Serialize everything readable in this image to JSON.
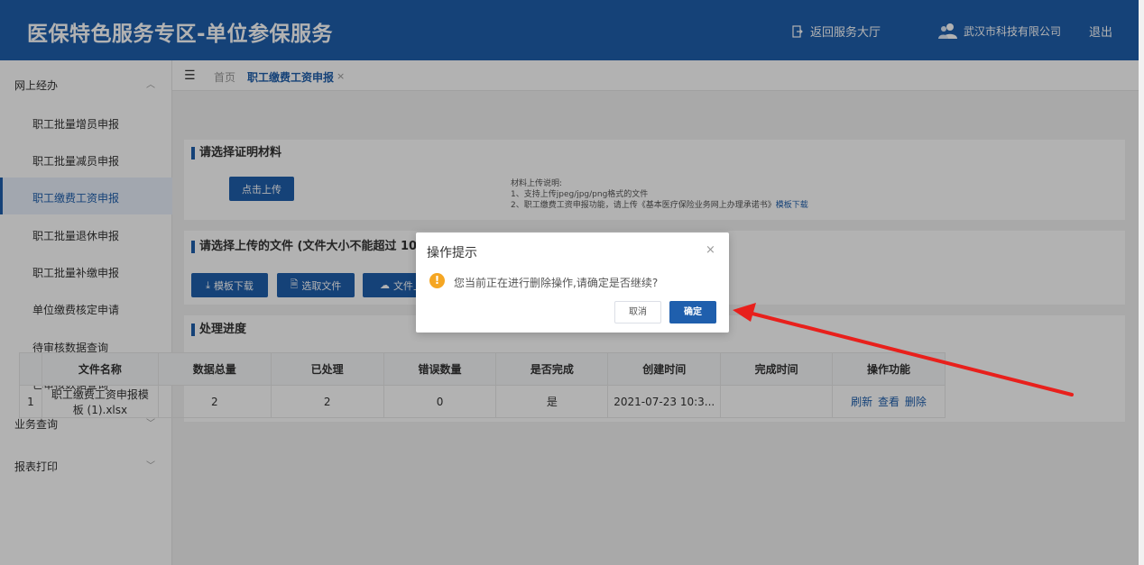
{
  "header": {
    "title": "医保特色服务专区-单位参保服务",
    "back_label": "返回服务大厅",
    "company": "武汉市科技有限公司",
    "logout": "退出"
  },
  "sidebar": {
    "group_online": "网上经办",
    "items": [
      {
        "label": "职工批量增员申报"
      },
      {
        "label": "职工批量减员申报"
      },
      {
        "label": "职工缴费工资申报"
      },
      {
        "label": "职工批量退休申报"
      },
      {
        "label": "职工批量补缴申报"
      },
      {
        "label": "单位缴费核定申请"
      },
      {
        "label": "待审核数据查询"
      },
      {
        "label": "已审核数据查询"
      }
    ],
    "group_query": "业务查询",
    "group_print": "报表打印"
  },
  "tabbar": {
    "home": "首页",
    "active_tab": "职工缴费工资申报",
    "close": "×"
  },
  "section_proof": {
    "title": "请选择证明材料",
    "upload_btn": "点击上传",
    "note_line1": "材料上传说明:",
    "note_line2": "1、支持上传jpeg/jpg/png格式的文件",
    "note_line3": "2、职工缴费工资申报功能，请上传《基本医疗保险业务网上办理承诺书》",
    "note_link": "模板下载"
  },
  "section_files": {
    "title": "请选择上传的文件 (文件大小不能超过 10",
    "btn_template": "模板下载",
    "btn_select": "选取文件",
    "btn_upload": "文件上"
  },
  "section_progress": {
    "title": "处理进度",
    "columns": [
      "",
      "文件名称",
      "数据总量",
      "已处理",
      "错误数量",
      "是否完成",
      "创建时间",
      "完成时间",
      "操作功能"
    ],
    "rows": [
      {
        "index": "1",
        "file_line1": "职工缴费工资申报模",
        "file_line2": "板 (1).xlsx",
        "total": "2",
        "processed": "2",
        "errors": "0",
        "done": "是",
        "created": "2021-07-23 10:3...",
        "finished": "",
        "op_refresh": "刷新",
        "op_view": "查看",
        "op_delete": "删除"
      }
    ]
  },
  "dialog": {
    "title": "操作提示",
    "close": "×",
    "icon": "!",
    "message": "您当前正在进行删除操作,请确定是否继续?",
    "cancel": "取消",
    "ok": "确定"
  },
  "annotation_color": "#e8201c",
  "brand_color": "#1f5fad"
}
